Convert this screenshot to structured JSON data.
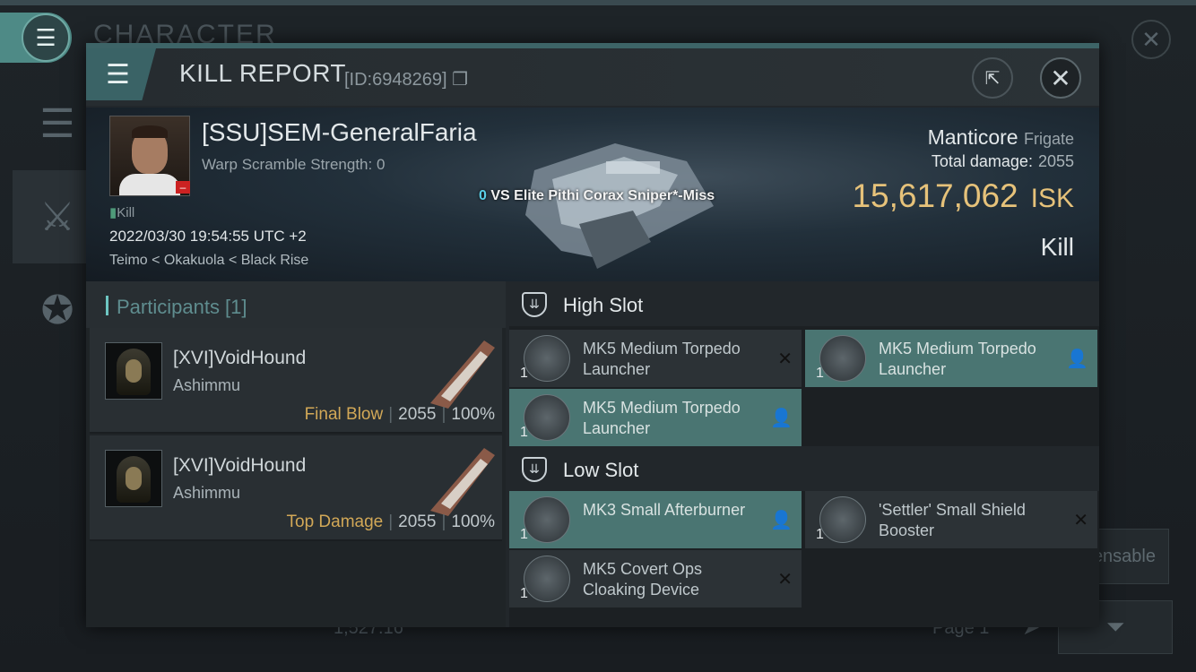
{
  "background": {
    "title": "CHARACTER",
    "dispensable_label": "ensable",
    "page_label": "Page 1",
    "amount": "1,527.16"
  },
  "modal": {
    "title": "KILL REPORT",
    "id": "[ID:6948269]"
  },
  "victim": {
    "name": "[SSU]SEM-GeneralFaria",
    "warp": "Warp Scramble Strength: 0",
    "kill_tag": "Kill",
    "date": "2022/03/30 19:54:55 UTC +2",
    "location": "Teimo < Okakuola < Black Rise",
    "vs_count": "0",
    "vs_text": "VS Elite Pithi Corax Sniper*-Miss",
    "ship": "Manticore",
    "ship_class": "Frigate",
    "total_damage_label": "Total damage:",
    "total_damage": "2055",
    "isk_value": "15,617,062",
    "isk_unit": "ISK",
    "result": "Kill"
  },
  "participants": {
    "header": "Participants [1]",
    "items": [
      {
        "name": "[XVI]VoidHound",
        "ship": "Ashimmu",
        "role": "Final Blow",
        "damage": "2055",
        "percent": "100%"
      },
      {
        "name": "[XVI]VoidHound",
        "ship": "Ashimmu",
        "role": "Top Damage",
        "damage": "2055",
        "percent": "100%"
      }
    ]
  },
  "slots": {
    "high_label": "High Slot",
    "low_label": "Low Slot",
    "high": [
      {
        "qty": "1",
        "name": "MK5 Medium Torpedo Launcher",
        "status": "destroyed"
      },
      {
        "qty": "1",
        "name": "MK5 Medium Torpedo Launcher",
        "status": "dropped"
      },
      {
        "qty": "1",
        "name": "MK5 Medium Torpedo Launcher",
        "status": "dropped"
      }
    ],
    "low": [
      {
        "qty": "1",
        "name": "MK3 Small Afterburner",
        "status": "dropped"
      },
      {
        "qty": "1",
        "name": "'Settler' Small Shield Booster",
        "status": "destroyed"
      },
      {
        "qty": "1",
        "name": "MK5 Covert Ops Cloaking Device",
        "status": "destroyed"
      }
    ]
  },
  "colors": {
    "accent": "#4e8a86",
    "isk": "#e6c27a",
    "final_blow": "#d2a857",
    "dropped_row": "#4a7572"
  }
}
